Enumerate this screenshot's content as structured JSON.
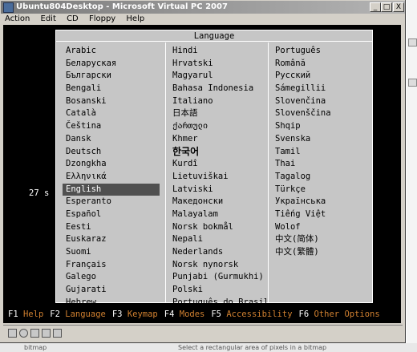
{
  "window": {
    "title": "Ubuntu804Desktop - Microsoft Virtual PC 2007",
    "minimize": "_",
    "maximize": "□",
    "close": "X"
  },
  "menu": [
    "Action",
    "Edit",
    "CD",
    "Floppy",
    "Help"
  ],
  "dialog": {
    "title": "Language",
    "selected": "English",
    "columns": [
      [
        "Arabic",
        "Беларуская",
        "Български",
        "Bengali",
        "Bosanski",
        "Català",
        "Čeština",
        "Dansk",
        "Deutsch",
        "Dzongkha",
        "Ελληνικά",
        "English",
        "Esperanto",
        "Español",
        "Eesti",
        "Euskaraz",
        "Suomi",
        "Français",
        "Galego",
        "Gujarati",
        "Hebrew"
      ],
      [
        "Hindi",
        "Hrvatski",
        "Magyarul",
        "Bahasa Indonesia",
        "Italiano",
        "日本語",
        "ქართული",
        "Khmer",
        "한국어",
        "Kurdî",
        "Lietuviškai",
        "Latviski",
        "Македонски",
        "Malayalam",
        "Norsk bokmål",
        "Nepali",
        "Nederlands",
        "Norsk nynorsk",
        "Punjabi (Gurmukhi)",
        "Polski",
        "Português do Brasil"
      ],
      [
        "Português",
        "Română",
        "Русский",
        "Sámegillii",
        "Slovenčina",
        "Slovenščina",
        "Shqip",
        "Svenska",
        "Tamil",
        "Thai",
        "Tagalog",
        "Türkçe",
        "Українська",
        "Tiếng Việt",
        "Wolof",
        "中文(简体)",
        "中文(繁體)"
      ]
    ]
  },
  "timer": "27 s",
  "fkeys": [
    {
      "key": "F1",
      "label": "Help"
    },
    {
      "key": "F2",
      "label": "Language"
    },
    {
      "key": "F3",
      "label": "Keymap"
    },
    {
      "key": "F4",
      "label": "Modes"
    },
    {
      "key": "F5",
      "label": "Accessibility"
    },
    {
      "key": "F6",
      "label": "Other Options"
    }
  ],
  "background": {
    "left_text": "bitmap",
    "right_text": "Select a rectangular area of pixels in a bitmap"
  }
}
